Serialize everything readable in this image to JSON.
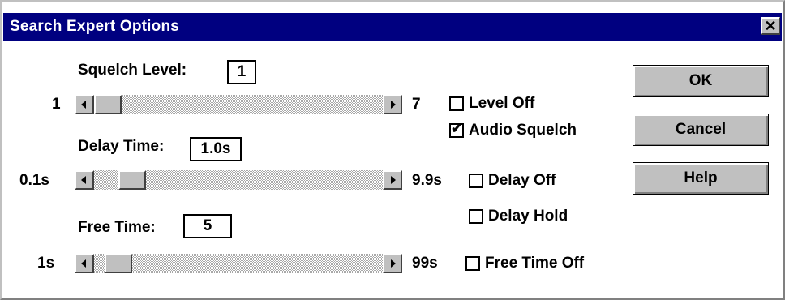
{
  "window": {
    "title": "Search Expert Options",
    "close_glyph": "✕"
  },
  "squelch": {
    "label": "Squelch Level:",
    "value": "1",
    "min_label": "1",
    "max_label": "7",
    "slider_min": 1,
    "slider_max": 7,
    "slider_value": 1
  },
  "delay": {
    "label": "Delay Time:",
    "value": "1.0s",
    "min_label": "0.1s",
    "max_label": "9.9s",
    "slider_min": 0.1,
    "slider_max": 9.9,
    "slider_value": 1.0
  },
  "free": {
    "label": "Free Time:",
    "value": "5",
    "min_label": "1s",
    "max_label": "99s",
    "slider_min": 1,
    "slider_max": 99,
    "slider_value": 5
  },
  "checkboxes": {
    "level_off": {
      "label": "Level Off",
      "checked": false
    },
    "audio_squelch": {
      "label": "Audio Squelch",
      "checked": true
    },
    "delay_off": {
      "label": "Delay Off",
      "checked": false
    },
    "delay_hold": {
      "label": "Delay Hold",
      "checked": false
    },
    "free_time_off": {
      "label": "Free Time Off",
      "checked": false
    }
  },
  "buttons": {
    "ok": "OK",
    "cancel": "Cancel",
    "help": "Help"
  },
  "icons": {
    "close": "close-icon",
    "scroll_left": "arrow-left-icon",
    "scroll_right": "arrow-right-icon",
    "check": "checkmark-icon"
  },
  "colors": {
    "title_bar": "#000080",
    "face": "#c0c0c0",
    "background": "#ffffff"
  }
}
